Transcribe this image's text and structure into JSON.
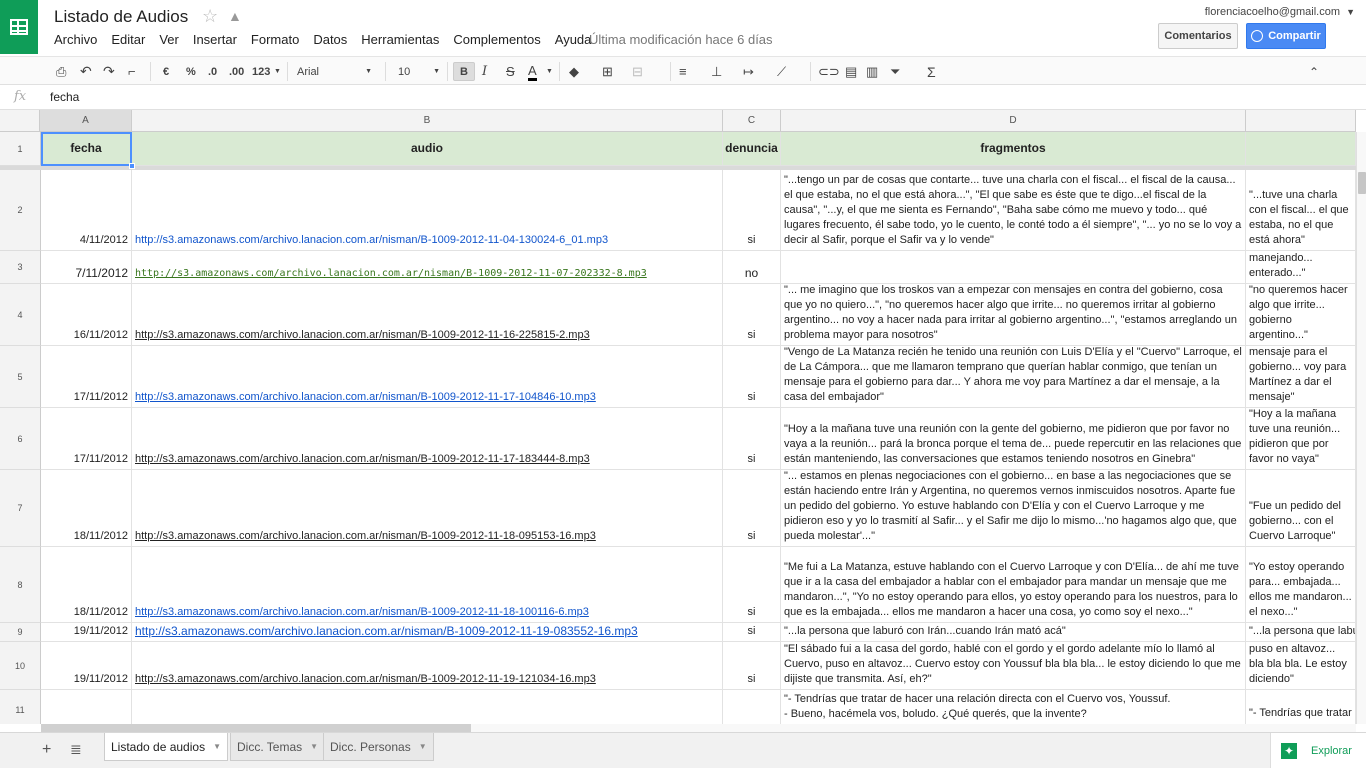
{
  "header": {
    "title": "Listado de Audios",
    "menu": [
      "Archivo",
      "Editar",
      "Ver",
      "Insertar",
      "Formato",
      "Datos",
      "Herramientas",
      "Complementos",
      "Ayuda"
    ],
    "last_modified": "Última modificación hace 6 días",
    "user_email": "florenciacoelho@gmail.com",
    "comments_label": "Comentarios",
    "share_label": "Compartir"
  },
  "toolbar": {
    "currency": "€",
    "percent": "%",
    "dec_decrease": ".0",
    "dec_increase": ".00",
    "number_format": "123",
    "font": "Arial",
    "size": "10",
    "bold": "B",
    "italic": "I",
    "strike": "S",
    "textcolor": "A",
    "sum": "Σ"
  },
  "formula_bar": {
    "fx": "fx",
    "value": "fecha"
  },
  "columns": [
    "A",
    "B",
    "C",
    "D"
  ],
  "header_row": {
    "num": "1",
    "a": "fecha",
    "b": "audio",
    "c": "denuncia",
    "d": "fragmentos"
  },
  "rows": [
    {
      "num": "2",
      "fecha": "4/11/2012",
      "audio": "http://s3.amazonaws.com/archivo.lanacion.com.ar/nisman/B-1009-2012-11-04-130024-6_01.mp3",
      "denuncia": "si",
      "fragmentos": "\"...tengo un par de cosas que contarte... tuve una charla con el fiscal... el fiscal de la causa... el que estaba, no el que está ahora...\", \"El que sabe es éste que te digo...el fiscal de la causa\", \"...y, el que me sienta es Fernando\", \"Baha sabe cómo me muevo y todo... qué lugares frecuento, él sabe todo, yo le cuento, le conté todo a él siempre\", \"... yo no se lo voy a decir al Safir, porque el Safir va y lo vende\"",
      "extra": "\"...tuve una charla con el fiscal... el que estaba, no el que está ahora\""
    },
    {
      "num": "3",
      "fecha": "7/11/2012",
      "audio": "http://s3.amazonaws.com/archivo.lanacion.com.ar/nisman/B-1009-2012-11-07-202332-8.mp3",
      "denuncia": "no",
      "fragmentos": "",
      "extra": "\"Se están manejando... enterado...\""
    },
    {
      "num": "4",
      "fecha": "16/11/2012",
      "audio": "http://s3.amazonaws.com/archivo.lanacion.com.ar/nisman/B-1009-2012-11-16-225815-2.mp3",
      "denuncia": "si",
      "fragmentos": "\"... me imagino que los troskos van a empezar con mensajes en contra del gobierno, cosa que yo no quiero...\",  \"no queremos hacer algo que irrite... no queremos irritar al gobierno argentino... no voy a hacer nada para irritar al gobierno argentino...\",  \"estamos arreglando un problema mayor para nosotros\"",
      "extra": "\"no queremos hacer algo que irrite... gobierno argentino...\""
    },
    {
      "num": "5",
      "fecha": "17/11/2012",
      "audio": "http://s3.amazonaws.com/archivo.lanacion.com.ar/nisman/B-1009-2012-11-17-104846-10.mp3",
      "denuncia": "si",
      "fragmentos": "\"Vengo de La Matanza recién he tenido una reunión con Luis D'Elía y el \"Cuervo\" Larroque, el de La Cámpora... que me llamaron temprano que querían hablar conmigo, que tenían un mensaje para el gobierno para dar... Y ahora me voy para Martínez a dar el mensaje, a la casa del embajador\"",
      "extra": "\"Que tenían un mensaje para el gobierno... voy para Martínez a dar el mensaje\""
    },
    {
      "num": "6",
      "fecha": "17/11/2012",
      "audio": "http://s3.amazonaws.com/archivo.lanacion.com.ar/nisman/B-1009-2012-11-17-183444-8.mp3",
      "denuncia": "si",
      "fragmentos": "\"Hoy a la mañana tuve una reunión con la gente del gobierno, me pidieron que por favor no vaya a la reunión... pará la bronca porque el tema de... puede repercutir en las relaciones que están manteniendo, las conversaciones que estamos teniendo nosotros en Ginebra\"",
      "extra": "\"Hoy a la mañana tuve una reunión... pidieron que por favor no vaya\""
    },
    {
      "num": "7",
      "fecha": "18/11/2012",
      "audio": "http://s3.amazonaws.com/archivo.lanacion.com.ar/nisman/B-1009-2012-11-18-095153-16.mp3",
      "denuncia": "si",
      "fragmentos": "\"... estamos en plenas negociaciones con el gobierno... en base a las negociaciones que se están haciendo entre Irán y Argentina, no queremos vernos inmiscuidos nosotros. Aparte fue un pedido del gobierno. Yo estuve hablando con D'Elía y con el Cuervo Larroque y me pidieron eso y yo lo trasmití al Safir... y el Safir me dijo lo mismo...'no hagamos algo que, que pueda molestar'...\"",
      "extra": "\"Fue un pedido del gobierno... con el Cuervo Larroque\""
    },
    {
      "num": "8",
      "fecha": "18/11/2012",
      "audio": "http://s3.amazonaws.com/archivo.lanacion.com.ar/nisman/B-1009-2012-11-18-100116-6.mp3",
      "denuncia": "si",
      "fragmentos": "\"Me fui a La Matanza, estuve hablando con el Cuervo Larroque y con D'Elía... de ahí me tuve que ir a la casa del embajador a hablar con el embajador para mandar un mensaje que me mandaron...\", \"Yo no estoy operando para ellos, yo estoy operando para los nuestros, para lo que es la embajada... ellos me mandaron a hacer una cosa, yo como soy el nexo...\"",
      "extra": "\"Yo estoy operando para... embajada... ellos me mandaron... el nexo...\""
    },
    {
      "num": "9",
      "fecha": "19/11/2012",
      "audio": "http://s3.amazonaws.com/archivo.lanacion.com.ar/nisman/B-1009-2012-11-19-083552-16.mp3",
      "denuncia": "si",
      "fragmentos": "\"...la persona que laburó con Irán...cuando Irán mató acá\"",
      "extra": "\"...la persona que laburó con Irán\""
    },
    {
      "num": "10",
      "fecha": "19/11/2012",
      "audio": "http://s3.amazonaws.com/archivo.lanacion.com.ar/nisman/B-1009-2012-11-19-121034-16.mp3",
      "denuncia": "si",
      "fragmentos": "\"El sábado fui a la casa del gordo, hablé con el gordo y el gordo adelante mío lo llamó al Cuervo, puso en altavoz... Cuervo estoy con Youssuf bla bla bla... le estoy diciendo lo que me dijiste que transmita. Así, eh?\"",
      "extra": "\"Lo llamó al Cuervo, puso en altavoz... bla bla bla. Le estoy diciendo\""
    },
    {
      "num": "11",
      "fecha": "",
      "audio": "",
      "denuncia": "",
      "fragmentos": "\"- Tendrías que tratar de hacer una relación directa con el Cuervo vos, Youssuf.\n- Bueno, hacémela vos, boludo. ¿Qué querés, que la invente?",
      "extra": "\"- Tendrías que tratar de hacer una relación directa\""
    }
  ],
  "sheets": {
    "tabs": [
      "Listado de audios",
      "Dicc. Temas",
      "Dicc. Personas"
    ],
    "explore_label": "Explorar"
  }
}
